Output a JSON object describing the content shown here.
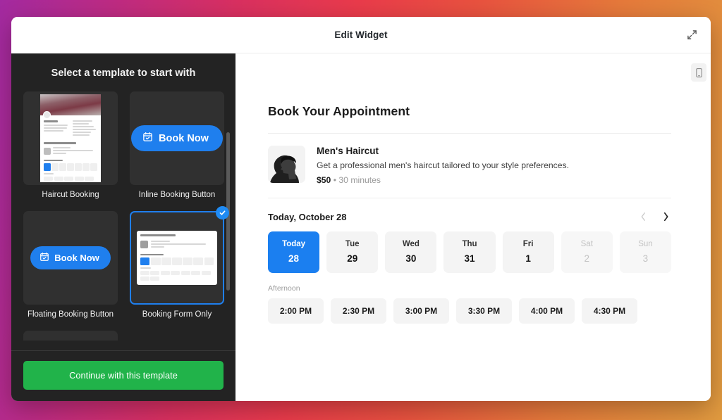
{
  "header": {
    "title": "Edit Widget",
    "expand_icon": "expand-diagonal-icon"
  },
  "sidebar": {
    "heading": "Select a template to start with",
    "templates": [
      {
        "label": "Haircut Booking",
        "preview": "mini-page",
        "selected": false
      },
      {
        "label": "Inline Booking Button",
        "preview": "book-now-pill",
        "button_label": "Book Now",
        "selected": false
      },
      {
        "label": "Floating Booking Button",
        "preview": "book-now-pill",
        "button_label": "Book Now",
        "selected": false
      },
      {
        "label": "Booking Form Only",
        "preview": "mini-form",
        "selected": true
      }
    ],
    "continue_label": "Continue with this template"
  },
  "preview": {
    "device_icon": "mobile-phone-icon",
    "title": "Book Your Appointment",
    "service": {
      "name": "Men's Haircut",
      "description": "Get a professional men's haircut tailored to your style preferences.",
      "price": "$50",
      "separator": "•",
      "duration": "30 minutes"
    },
    "date_header": {
      "label": "Today, October 28",
      "prev_icon": "chevron-left-icon",
      "next_icon": "chevron-right-icon"
    },
    "days": [
      {
        "dow": "Today",
        "num": "28",
        "state": "active"
      },
      {
        "dow": "Tue",
        "num": "29",
        "state": "available"
      },
      {
        "dow": "Wed",
        "num": "30",
        "state": "available"
      },
      {
        "dow": "Thu",
        "num": "31",
        "state": "available"
      },
      {
        "dow": "Fri",
        "num": "1",
        "state": "available"
      },
      {
        "dow": "Sat",
        "num": "2",
        "state": "disabled"
      },
      {
        "dow": "Sun",
        "num": "3",
        "state": "disabled"
      }
    ],
    "slot_group_label": "Afternoon",
    "slots": [
      "2:00 PM",
      "2:30 PM",
      "3:00 PM",
      "3:30 PM",
      "4:00 PM",
      "4:30 PM"
    ]
  },
  "colors": {
    "accent_blue": "#1b7ff0",
    "continue_green": "#21b34a",
    "sidebar_bg": "#232323",
    "card_bg": "#303030"
  }
}
